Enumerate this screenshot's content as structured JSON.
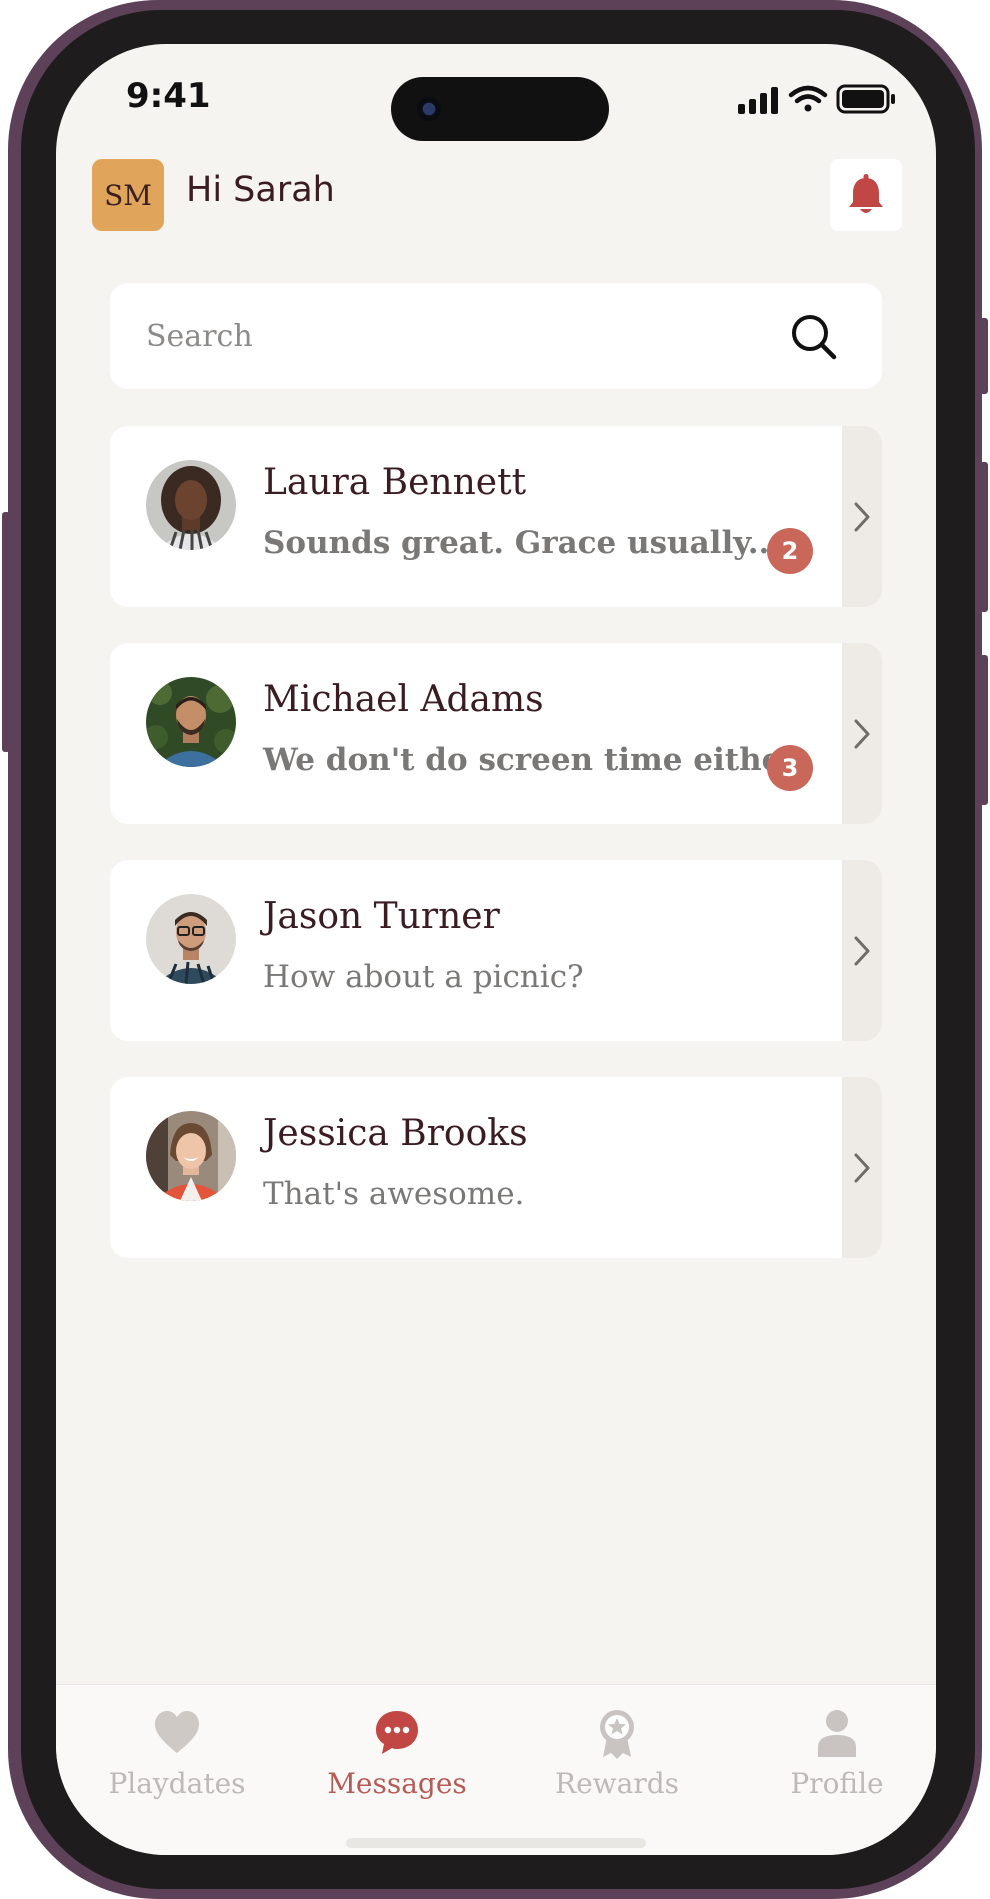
{
  "status_bar": {
    "time": "9:41"
  },
  "header": {
    "initials": "SM",
    "greeting": "Hi Sarah"
  },
  "search": {
    "placeholder": "Search"
  },
  "conversations": [
    {
      "name": "Laura Bennett",
      "message": "Sounds great. Grace usually...",
      "unread": "2"
    },
    {
      "name": "Michael Adams",
      "message": "We don't do screen time either",
      "unread": "3"
    },
    {
      "name": "Jason Turner",
      "message": "How about a picnic?",
      "unread": ""
    },
    {
      "name": "Jessica Brooks",
      "message": "That's awesome.",
      "unread": ""
    }
  ],
  "tabs": [
    {
      "label": "Playdates",
      "icon": "heart-icon",
      "active": false
    },
    {
      "label": "Messages",
      "icon": "chat-bubble-icon",
      "active": true
    },
    {
      "label": "Rewards",
      "icon": "award-icon",
      "active": false
    },
    {
      "label": "Profile",
      "icon": "person-icon",
      "active": false
    }
  ],
  "colors": {
    "accent": "#c9675a",
    "background": "#f6f4f1",
    "avatar": "#e1a45b",
    "text_dark": "#3b1c22",
    "frame": "#5d4158"
  }
}
